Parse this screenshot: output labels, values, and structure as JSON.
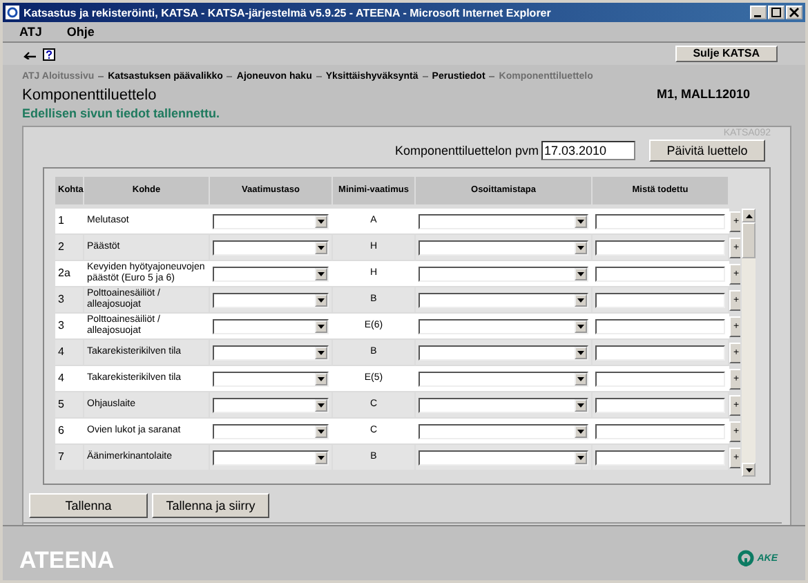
{
  "window": {
    "title": "Katsastus ja rekisteröinti, KATSA - KATSA-järjestelmä v5.9.25 - ATEENA - Microsoft Internet Explorer"
  },
  "menu": [
    "ATJ",
    "Ohje"
  ],
  "toolbar": {
    "close_button": "Sulje KATSA"
  },
  "breadcrumb": [
    {
      "label": "ATJ Aloitussivu",
      "disabled": true
    },
    {
      "label": "Katsastuksen päävalikko",
      "disabled": false
    },
    {
      "label": "Ajoneuvon haku",
      "disabled": false
    },
    {
      "label": "Yksittäishyväksyntä",
      "disabled": false
    },
    {
      "label": "Perustiedot",
      "disabled": false
    },
    {
      "label": "Komponenttiluettelo",
      "disabled": true
    }
  ],
  "page": {
    "title": "Komponenttiluettelo",
    "vehicle": "M1, MALL12010",
    "message": "Edellisen sivun tiedot tallennettu.",
    "screen_id": "KATSA092"
  },
  "date_field": {
    "label": "Komponenttiluettelon pvm",
    "value": "17.03.2010",
    "button": "Päivitä luettelo"
  },
  "table": {
    "columns": [
      "Kohta",
      "Kohde",
      "Vaatimustaso",
      "Minimi-vaatimus",
      "Osoittamistapa",
      "Mistä todettu"
    ],
    "rows": [
      {
        "kohta": "1",
        "kohde": "Melutasot",
        "minimi": "A"
      },
      {
        "kohta": "2",
        "kohde": "Päästöt",
        "minimi": "H"
      },
      {
        "kohta": "2a",
        "kohde": "Kevyiden hyötyajoneuvojen päästöt (Euro 5 ja 6)",
        "minimi": "H"
      },
      {
        "kohta": "3",
        "kohde": "Polttoainesäiliöt / alleajosuojat",
        "minimi": "B"
      },
      {
        "kohta": "3",
        "kohde": "Polttoainesäiliöt / alleajosuojat",
        "minimi": "E(6)"
      },
      {
        "kohta": "4",
        "kohde": "Takarekisterikilven tila",
        "minimi": "B"
      },
      {
        "kohta": "4",
        "kohde": "Takarekisterikilven tila",
        "minimi": "E(5)"
      },
      {
        "kohta": "5",
        "kohde": "Ohjauslaite",
        "minimi": "C"
      },
      {
        "kohta": "6",
        "kohde": "Ovien lukot ja saranat",
        "minimi": "C"
      },
      {
        "kohta": "7",
        "kohde": "Äänimerkinantolaite",
        "minimi": "B"
      }
    ],
    "add_button": "+"
  },
  "buttons": [
    "Tallenna",
    "Tallenna ja siirry"
  ],
  "footer": {
    "brand": "ATEENA",
    "logo": "AKE"
  }
}
